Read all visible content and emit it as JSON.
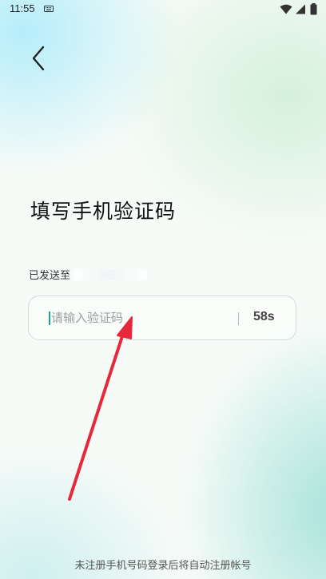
{
  "status_bar": {
    "time": "11:55",
    "icons": [
      "keyboard-icon",
      "wifi-icon",
      "signal-icon",
      "battery-icon"
    ]
  },
  "header": {
    "back_icon": "chevron-left-icon"
  },
  "main": {
    "title": "填写手机验证码",
    "sent_to_label": "已发送至",
    "masked_phone": "177",
    "code_input": {
      "placeholder": "请输入验证码",
      "value": ""
    },
    "countdown": "58s"
  },
  "footer": {
    "note": "未注册手机号码登录后将自动注册帐号"
  },
  "colors": {
    "caret": "#1aa58f",
    "annotation_arrow": "#e8283a"
  }
}
